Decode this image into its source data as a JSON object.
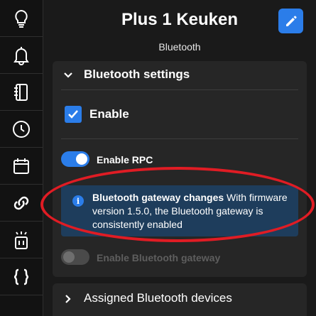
{
  "sidebar": {
    "items": [
      {
        "icon": "lightbulb-icon"
      },
      {
        "icon": "bell-icon"
      },
      {
        "icon": "notebook-icon"
      },
      {
        "icon": "clock-icon"
      },
      {
        "icon": "calendar-icon"
      },
      {
        "icon": "link-icon"
      },
      {
        "icon": "device-icon"
      },
      {
        "icon": "braces-icon"
      }
    ]
  },
  "header": {
    "title": "Plus 1 Keuken",
    "subtitle": "Bluetooth",
    "edit_icon": "pencil-icon"
  },
  "settings_panel": {
    "title": "Bluetooth settings",
    "enable_label": "Enable",
    "enable_checked": true,
    "rpc": {
      "label": "Enable RPC",
      "on": true
    },
    "notice": {
      "title": "Bluetooth gateway changes",
      "body": "With firmware version 1.5.0, the Bluetooth gateway is consistently enabled"
    },
    "gateway": {
      "label": "Enable Bluetooth gateway",
      "on": false,
      "disabled": true
    }
  },
  "devices_panel": {
    "title": "Assigned Bluetooth devices"
  },
  "colors": {
    "accent": "#2b7de9",
    "background": "#1a1a1a",
    "panel": "#262626",
    "notice_bg": "#1e3d5c",
    "annotation": "#e01c24"
  }
}
